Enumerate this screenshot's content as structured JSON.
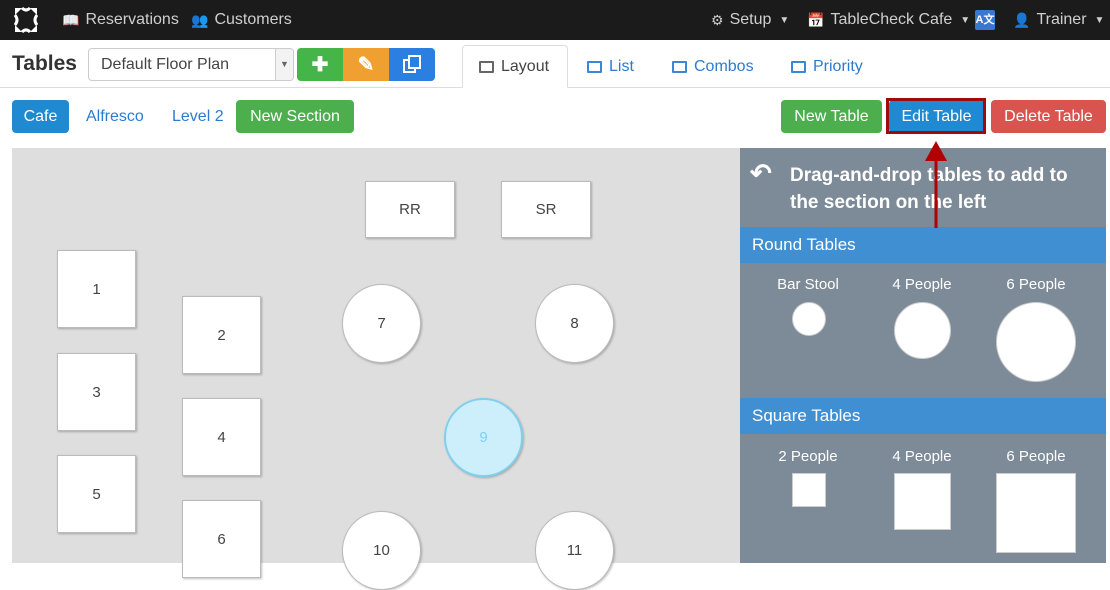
{
  "topnav": {
    "reservations": "Reservations",
    "customers": "Customers",
    "setup": "Setup",
    "venue": "TableCheck Cafe",
    "user": "Trainer"
  },
  "header": {
    "title": "Tables",
    "floor_plan": "Default Floor Plan",
    "tabs": [
      {
        "label": "Layout",
        "icon": "grid-icon"
      },
      {
        "label": "List",
        "icon": "list-icon"
      },
      {
        "label": "Combos",
        "icon": "combos-icon"
      },
      {
        "label": "Priority",
        "icon": "priority-icon"
      }
    ],
    "active_tab": "Layout"
  },
  "sections": {
    "items": [
      "Cafe",
      "Alfresco",
      "Level 2"
    ],
    "active": "Cafe",
    "new_section": "New Section"
  },
  "actions": {
    "new_table": "New Table",
    "edit_table": "Edit Table",
    "delete_table": "Delete Table"
  },
  "floor": {
    "tables": [
      "RR",
      "SR",
      "1",
      "2",
      "3",
      "4",
      "5",
      "6",
      "7",
      "8",
      "9",
      "10",
      "11"
    ],
    "selected": "9"
  },
  "panel": {
    "instruction": "Drag-and-drop tables to add to the section on the left",
    "round_heading": "Round Tables",
    "round_options": [
      "Bar Stool",
      "4 People",
      "6 People"
    ],
    "square_heading": "Square Tables",
    "square_options": [
      "2 People",
      "4 People",
      "6 People"
    ]
  },
  "colors": {
    "nav_bg": "#1b1b1b",
    "accent_blue": "#1f8ad1",
    "green": "#4cae4c",
    "red": "#d9534f",
    "highlight": "#a00a0a",
    "panel_bg": "#7d8a97"
  }
}
